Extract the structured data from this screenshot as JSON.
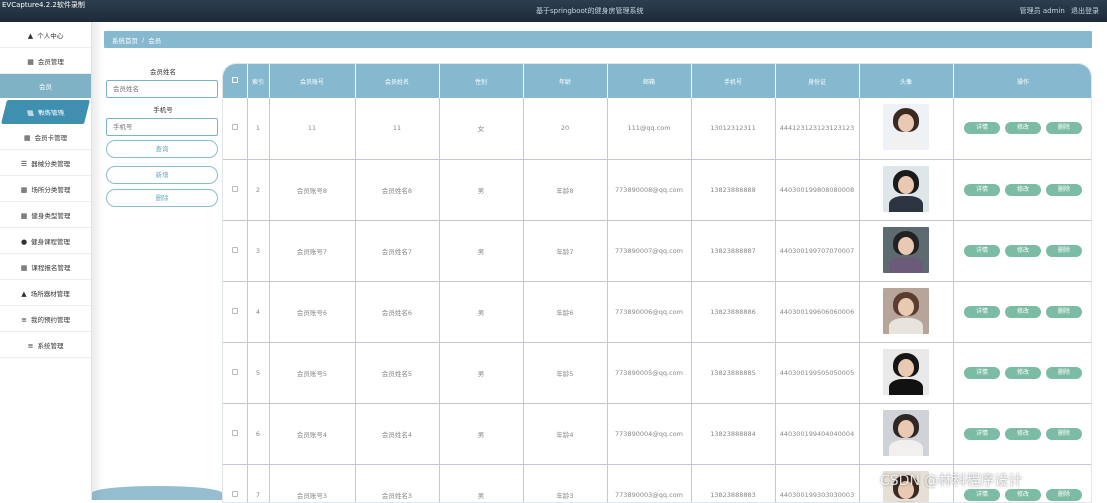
{
  "recorder_title": "EVCapture4.2.2软件录制",
  "system_title": "基于springboot的健身房管理系统",
  "user": {
    "greeting": "管理员 admin",
    "logout": "退出登录"
  },
  "sidebar": {
    "items": [
      {
        "label": "个人中心",
        "icon": "user-icon"
      },
      {
        "label": "会员管理",
        "icon": "grid-icon"
      },
      {
        "label": "会员",
        "icon": ""
      },
      {
        "label": "教练管理",
        "icon": "grid-icon"
      },
      {
        "label": "会员卡管理",
        "icon": "grid-icon"
      },
      {
        "label": "器械分类管理",
        "icon": "sliders-icon"
      },
      {
        "label": "场所分类管理",
        "icon": "grid-icon"
      },
      {
        "label": "健身类型管理",
        "icon": "grid-icon"
      },
      {
        "label": "健身课程管理",
        "icon": "bulb-icon"
      },
      {
        "label": "课程报名管理",
        "icon": "grid-icon"
      },
      {
        "label": "场所器材管理",
        "icon": "user-icon"
      },
      {
        "label": "我的预约管理",
        "icon": "list-icon"
      },
      {
        "label": "系统管理",
        "icon": "menu-icon"
      }
    ]
  },
  "breadcrumb": {
    "home": "系统首页",
    "current": "会员"
  },
  "search": {
    "name_label": "会员姓名",
    "name_placeholder": "会员姓名",
    "phone_label": "手机号",
    "phone_placeholder": "手机号",
    "query": "查询",
    "add": "新增",
    "delete": "删除"
  },
  "table": {
    "columns": [
      "",
      "索引",
      "会员账号",
      "会员姓名",
      "性别",
      "年龄",
      "邮箱",
      "手机号",
      "身份证",
      "头像",
      "操作"
    ],
    "actions": {
      "detail": "详情",
      "edit": "修改",
      "delete": "删除"
    },
    "rows": [
      {
        "index": "1",
        "account": "11",
        "name": "11",
        "gender": "女",
        "age": "20",
        "email": "111@qq.com",
        "phone": "13012312311",
        "idcard": "444123123123123123",
        "avatar_hair": "#3b2a22",
        "avatar_body": "#f1f1f1",
        "avatar_bg": "#eef1f5"
      },
      {
        "index": "2",
        "account": "会员账号8",
        "name": "会员姓名8",
        "gender": "男",
        "age": "年龄8",
        "email": "773890008@qq.com",
        "phone": "13823888888",
        "idcard": "440300199808080008",
        "avatar_hair": "#1a1a1a",
        "avatar_body": "#2c3440",
        "avatar_bg": "#dfe6ea"
      },
      {
        "index": "3",
        "account": "会员账号7",
        "name": "会员姓名7",
        "gender": "男",
        "age": "年龄7",
        "email": "773890007@qq.com",
        "phone": "13823888887",
        "idcard": "440300199707070007",
        "avatar_hair": "#222222",
        "avatar_body": "#6b5a7a",
        "avatar_bg": "#5d6a6f"
      },
      {
        "index": "4",
        "account": "会员账号6",
        "name": "会员姓名6",
        "gender": "男",
        "age": "年龄6",
        "email": "773890006@qq.com",
        "phone": "13823888886",
        "idcard": "440300199606060006",
        "avatar_hair": "#5a3d2e",
        "avatar_body": "#e8e3dc",
        "avatar_bg": "#b7a49a"
      },
      {
        "index": "5",
        "account": "会员账号5",
        "name": "会员姓名5",
        "gender": "男",
        "age": "年龄5",
        "email": "773890005@qq.com",
        "phone": "13823888885",
        "idcard": "440300199505050005",
        "avatar_hair": "#151515",
        "avatar_body": "#111111",
        "avatar_bg": "#e9e9e9"
      },
      {
        "index": "6",
        "account": "会员账号4",
        "name": "会员姓名4",
        "gender": "男",
        "age": "年龄4",
        "email": "773890004@qq.com",
        "phone": "13823888884",
        "idcard": "440300199404040004",
        "avatar_hair": "#2e2723",
        "avatar_body": "#f2f0ee",
        "avatar_bg": "#cfd2d6"
      },
      {
        "index": "7",
        "account": "会员账号3",
        "name": "会员姓名3",
        "gender": "男",
        "age": "年龄3",
        "email": "773890003@qq.com",
        "phone": "13823888883",
        "idcard": "440300199303030003",
        "avatar_hair": "#3a2a20",
        "avatar_body": "#d9c7b6",
        "avatar_bg": "#e6dfd6"
      }
    ]
  },
  "watermark": "CSDN @林科程序设计"
}
